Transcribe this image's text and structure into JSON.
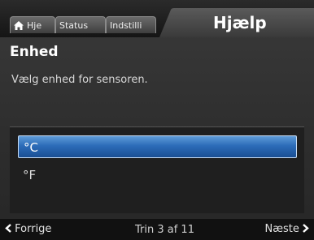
{
  "tabs": [
    {
      "label": "Hje",
      "icon": "home-icon"
    },
    {
      "label": "Status"
    },
    {
      "label": "Indstilli"
    }
  ],
  "title": "Hjælp",
  "heading": "Enhed",
  "description": "Vælg enhed for sensoren.",
  "options": [
    {
      "label": "°C",
      "selected": true
    },
    {
      "label": "°F",
      "selected": false
    }
  ],
  "footer": {
    "prev_label": "Forrige",
    "step_text": "Trin 3 af 11",
    "next_label": "Næste"
  },
  "colors": {
    "selection": "#2c6cb8",
    "background": "#2f2f2f"
  }
}
